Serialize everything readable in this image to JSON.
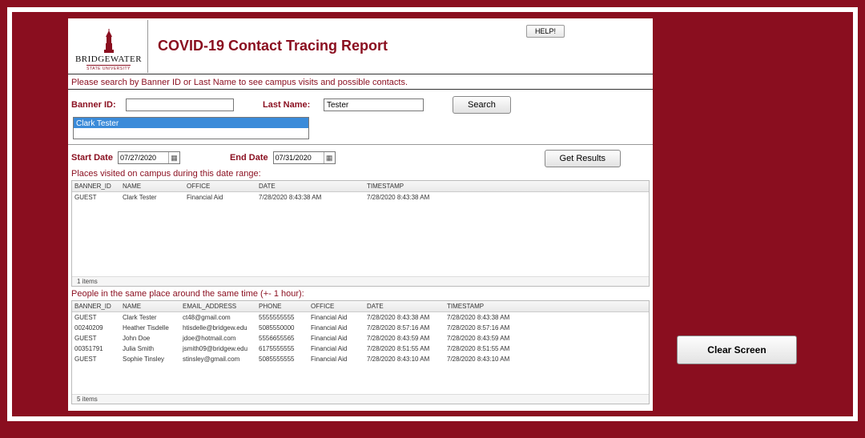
{
  "header": {
    "logo_main": "BRIDGEWATER",
    "logo_sub": "STATE UNIVERSITY",
    "title": "COVID-19 Contact Tracing Report",
    "help_label": "HELP!"
  },
  "instructions": "Please search by Banner ID or Last Name to see campus visits and possible contacts.",
  "search": {
    "banner_label": "Banner ID:",
    "banner_value": "",
    "lastname_label": "Last Name:",
    "lastname_value": "Tester",
    "search_label": "Search",
    "result_selected": "Clark Tester"
  },
  "dates": {
    "start_label": "Start Date",
    "start_value": "07/27/2020",
    "end_label": "End Date",
    "end_value": "07/31/2020",
    "get_results_label": "Get Results"
  },
  "places": {
    "title": "Places visited on campus during this date range:",
    "columns": [
      "BANNER_ID",
      "NAME",
      "OFFICE",
      "DATE",
      "TIMESTAMP"
    ],
    "rows": [
      {
        "banner_id": "GUEST",
        "name": "Clark Tester",
        "office": "Financial Aid",
        "date": "7/28/2020 8:43:38 AM",
        "timestamp": "7/28/2020 8:43:38 AM"
      }
    ],
    "footer": "1 items"
  },
  "people": {
    "title": "People in the same place around the same time (+- 1 hour):",
    "columns": [
      "BANNER_ID",
      "NAME",
      "EMAIL_ADDRESS",
      "PHONE",
      "OFFICE",
      "DATE",
      "TIMESTAMP"
    ],
    "rows": [
      {
        "banner_id": "GUEST",
        "name": "Clark Tester",
        "email": "ct48@gmail.com",
        "phone": "5555555555",
        "office": "Financial Aid",
        "date": "7/28/2020 8:43:38 AM",
        "timestamp": "7/28/2020 8:43:38 AM"
      },
      {
        "banner_id": "00240209",
        "name": "Heather Tisdelle",
        "email": "htisdelle@bridgew.edu",
        "phone": "5085550000",
        "office": "Financial Aid",
        "date": "7/28/2020 8:57:16 AM",
        "timestamp": "7/28/2020 8:57:16 AM"
      },
      {
        "banner_id": "GUEST",
        "name": "John Doe",
        "email": "jdoe@hotmail.com",
        "phone": "5556655565",
        "office": "Financial Aid",
        "date": "7/28/2020 8:43:59 AM",
        "timestamp": "7/28/2020 8:43:59 AM"
      },
      {
        "banner_id": "00351791",
        "name": "Julia Smith",
        "email": "jsmith09@bridgew.edu",
        "phone": "6175555555",
        "office": "Financial Aid",
        "date": "7/28/2020 8:51:55 AM",
        "timestamp": "7/28/2020 8:51:55 AM"
      },
      {
        "banner_id": "GUEST",
        "name": "Sophie Tinsley",
        "email": "stinsley@gmail.com",
        "phone": "5085555555",
        "office": "Financial Aid",
        "date": "7/28/2020 8:43:10 AM",
        "timestamp": "7/28/2020 8:43:10 AM"
      }
    ],
    "footer": "5 items"
  },
  "clear_screen_label": "Clear Screen"
}
